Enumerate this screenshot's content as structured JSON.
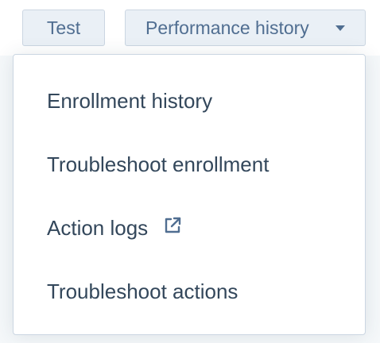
{
  "toolbar": {
    "test_label": "Test",
    "performance_history_label": "Performance history"
  },
  "dropdown": {
    "items": [
      {
        "label": "Enrollment history"
      },
      {
        "label": "Troubleshoot enrollment"
      },
      {
        "label": "Action logs",
        "icon": "external-link-icon"
      },
      {
        "label": "Troubleshoot actions"
      }
    ]
  },
  "colors": {
    "page_background": "#f5f8fa",
    "button_background": "#eaf0f6",
    "button_border": "#cbd6e2",
    "button_text": "#506e91",
    "menu_text": "#33475b",
    "icon_color": "#506e91"
  }
}
